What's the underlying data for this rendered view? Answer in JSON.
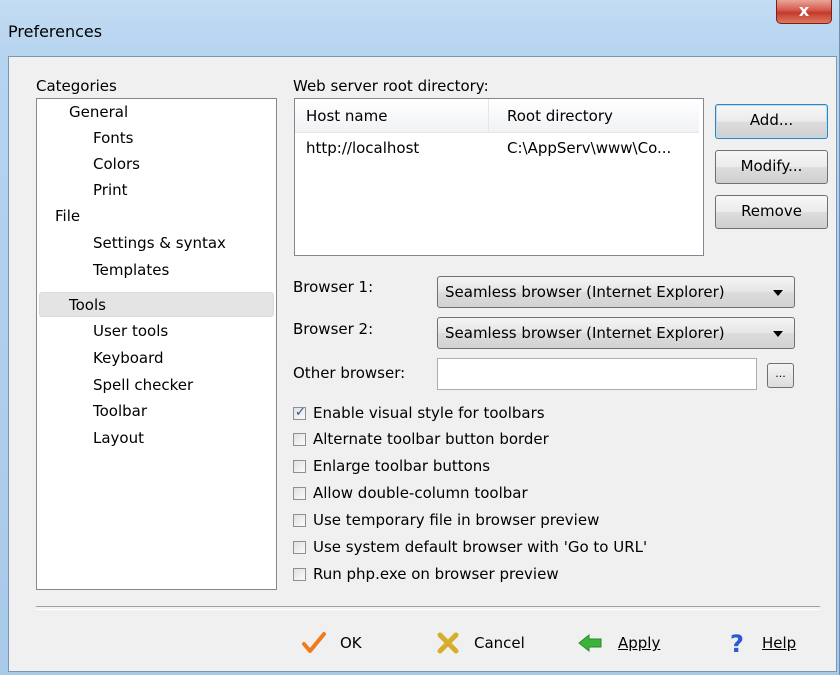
{
  "window": {
    "title": "Preferences",
    "close_symbol": "x"
  },
  "categories": {
    "label": "Categories",
    "items": [
      {
        "label": "General",
        "level": 1
      },
      {
        "label": "Fonts",
        "level": 2
      },
      {
        "label": "Colors",
        "level": 2
      },
      {
        "label": "Print",
        "level": 2
      },
      {
        "label": "File",
        "level": 1
      },
      {
        "label": "Settings & syntax",
        "level": 2
      },
      {
        "label": "Templates",
        "level": 2
      },
      {
        "label": "Tools",
        "level": 1,
        "selected": true
      },
      {
        "label": "User tools",
        "level": 2
      },
      {
        "label": "Keyboard",
        "level": 2
      },
      {
        "label": "Spell checker",
        "level": 2
      },
      {
        "label": "Toolbar",
        "level": 2
      },
      {
        "label": "Layout",
        "level": 2
      }
    ]
  },
  "server": {
    "label": "Web server root directory:",
    "columns": [
      "Host name",
      "Root directory"
    ],
    "rows": [
      {
        "host": "http://localhost",
        "root": "C:\\AppServ\\www\\Co..."
      }
    ],
    "add_label": "Add...",
    "modify_label": "Modify...",
    "remove_label": "Remove"
  },
  "browsers": {
    "browser1_label": "Browser 1:",
    "browser1_value": "Seamless browser (Internet Explorer)",
    "browser2_label": "Browser 2:",
    "browser2_value": "Seamless browser (Internet Explorer)",
    "other_label": "Other browser:",
    "other_value": "",
    "browse_label": "..."
  },
  "options": [
    {
      "label": "Enable visual style for toolbars",
      "checked": true
    },
    {
      "label": "Alternate toolbar button border",
      "checked": false
    },
    {
      "label": "Enlarge toolbar buttons",
      "checked": false
    },
    {
      "label": "Allow double-column toolbar",
      "checked": false
    },
    {
      "label": "Use temporary file in browser preview",
      "checked": false
    },
    {
      "label": "Use system default browser with 'Go to URL'",
      "checked": false
    },
    {
      "label": "Run php.exe on browser preview",
      "checked": false
    }
  ],
  "footer": {
    "ok_label": "OK",
    "cancel_label": "Cancel",
    "apply_label": "Apply",
    "help_label": "Help",
    "ok_icon": "checkmark-icon",
    "cancel_icon": "x-cross-icon",
    "apply_icon": "left-arrow-icon",
    "help_icon": "question-mark-icon"
  },
  "colors": {
    "check_orange": "#f07b1d",
    "cancel_gold": "#d7ad2c",
    "apply_green": "#3cb43c",
    "help_blue": "#2a5bd7"
  }
}
